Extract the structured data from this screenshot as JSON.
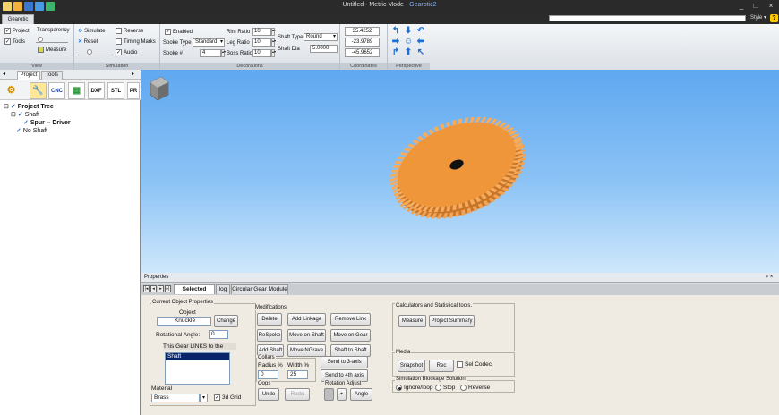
{
  "window": {
    "title": "Untitled -  Metric Mode - ",
    "app_name": "Gearotic2",
    "minimize": "_",
    "maximize": "□",
    "close": "×"
  },
  "ribbon_tab": "Gearotic",
  "style_label": "Style",
  "help_label": "?",
  "view_group": {
    "project": "Project",
    "tools": "Tools",
    "transparency": "Transparency",
    "measure": "Measure",
    "label": "View"
  },
  "simulation_group": {
    "simulate": "Simulate",
    "reset": "Reset",
    "reverse": "Reverse",
    "timing_marks": "Timing Marks",
    "audio": "Audio",
    "label": "Simulation"
  },
  "decorations_group": {
    "enabled": "Enabled",
    "spoke_type_label": "Spoke Type",
    "spoke_type": "Standard",
    "spoke_num_label": "Spoke #",
    "spoke_num": "4",
    "rim_ratio_label": "Rim Ratio",
    "rim_ratio": "10",
    "leg_ratio_label": "Leg Ratio",
    "leg_ratio": "10",
    "boss_ratio_label": "Boss Ratio",
    "boss_ratio": "10",
    "shaft_type_label": "Shaft Type",
    "shaft_type": "Round",
    "shaft_dia_label": "Shaft Dia",
    "shaft_dia": "5.0000",
    "label": "Decorations"
  },
  "coordinates_group": {
    "x": "35.4252",
    "y": "-23.9789",
    "z": "-45.9652",
    "label": "Coordinates"
  },
  "perspective_group": {
    "label": "Perspective"
  },
  "left_panel": {
    "tabs": [
      "Project",
      "Tools"
    ],
    "tools": [
      "CNC",
      "DXF",
      "STL",
      "PR"
    ],
    "tree": {
      "root": "Project Tree",
      "shaft": "Shaft",
      "spur": "Spur -- Driver",
      "no_shaft": "No Shaft"
    }
  },
  "properties": {
    "header": "Properties",
    "tabs": [
      "Selected Props",
      "log",
      "Circular Gear Module"
    ],
    "current": {
      "title": "Current Object Properties",
      "object_label": "Object",
      "object_value": "Knuckle",
      "change": "Change",
      "rot_angle_label": "Rotational Angle:",
      "rot_angle": "0",
      "links_label": "This Gear LINKS to the",
      "links_item": "Shaft",
      "material_label": "Material",
      "material": "Brass",
      "grid_label": "3d Grid"
    },
    "mods": {
      "title": "Modifications",
      "delete": "Delete",
      "add_linkage": "Add Linkage",
      "remove_link": "Remove Link",
      "respoke": "ReSpoke",
      "move_on_shaft": "Move on Shaft",
      "move_on_gear": "Move on Gear",
      "add_shaft": "Add Shaft",
      "move_ngrave": "Move NGrave",
      "shaft_to_shaft": "Shaft to Shaft",
      "collars": "Collars",
      "radius_label": "Radius %",
      "width_label": "Width %",
      "radius": "0",
      "width": "25",
      "send_3": "Send to 3-axis",
      "send_4": "Send to 4th axis",
      "oops": "Oops",
      "undo": "Undo",
      "redo": "Redo",
      "rotation_adjust": "Rotation Adjust",
      "minus": "-",
      "plus": "+",
      "angle": "Angle"
    },
    "calc": {
      "title": "Calculators and Statistical tools.",
      "measure": "Measure",
      "project_summary": "Project Summary"
    },
    "media": {
      "title": "Media",
      "snapshot": "Snapshot",
      "rec": "Rec",
      "sel_codec": "Sel Codec"
    },
    "blockage": {
      "title": "Simulation Blockage Solution",
      "ignore": "Ignore/loop",
      "stop": "Stop",
      "reverse": "Reverse"
    }
  },
  "colors": {
    "gear": "#f0963a",
    "sky_top": "#5fa8f0",
    "sky_bottom": "#cfe7fb"
  }
}
